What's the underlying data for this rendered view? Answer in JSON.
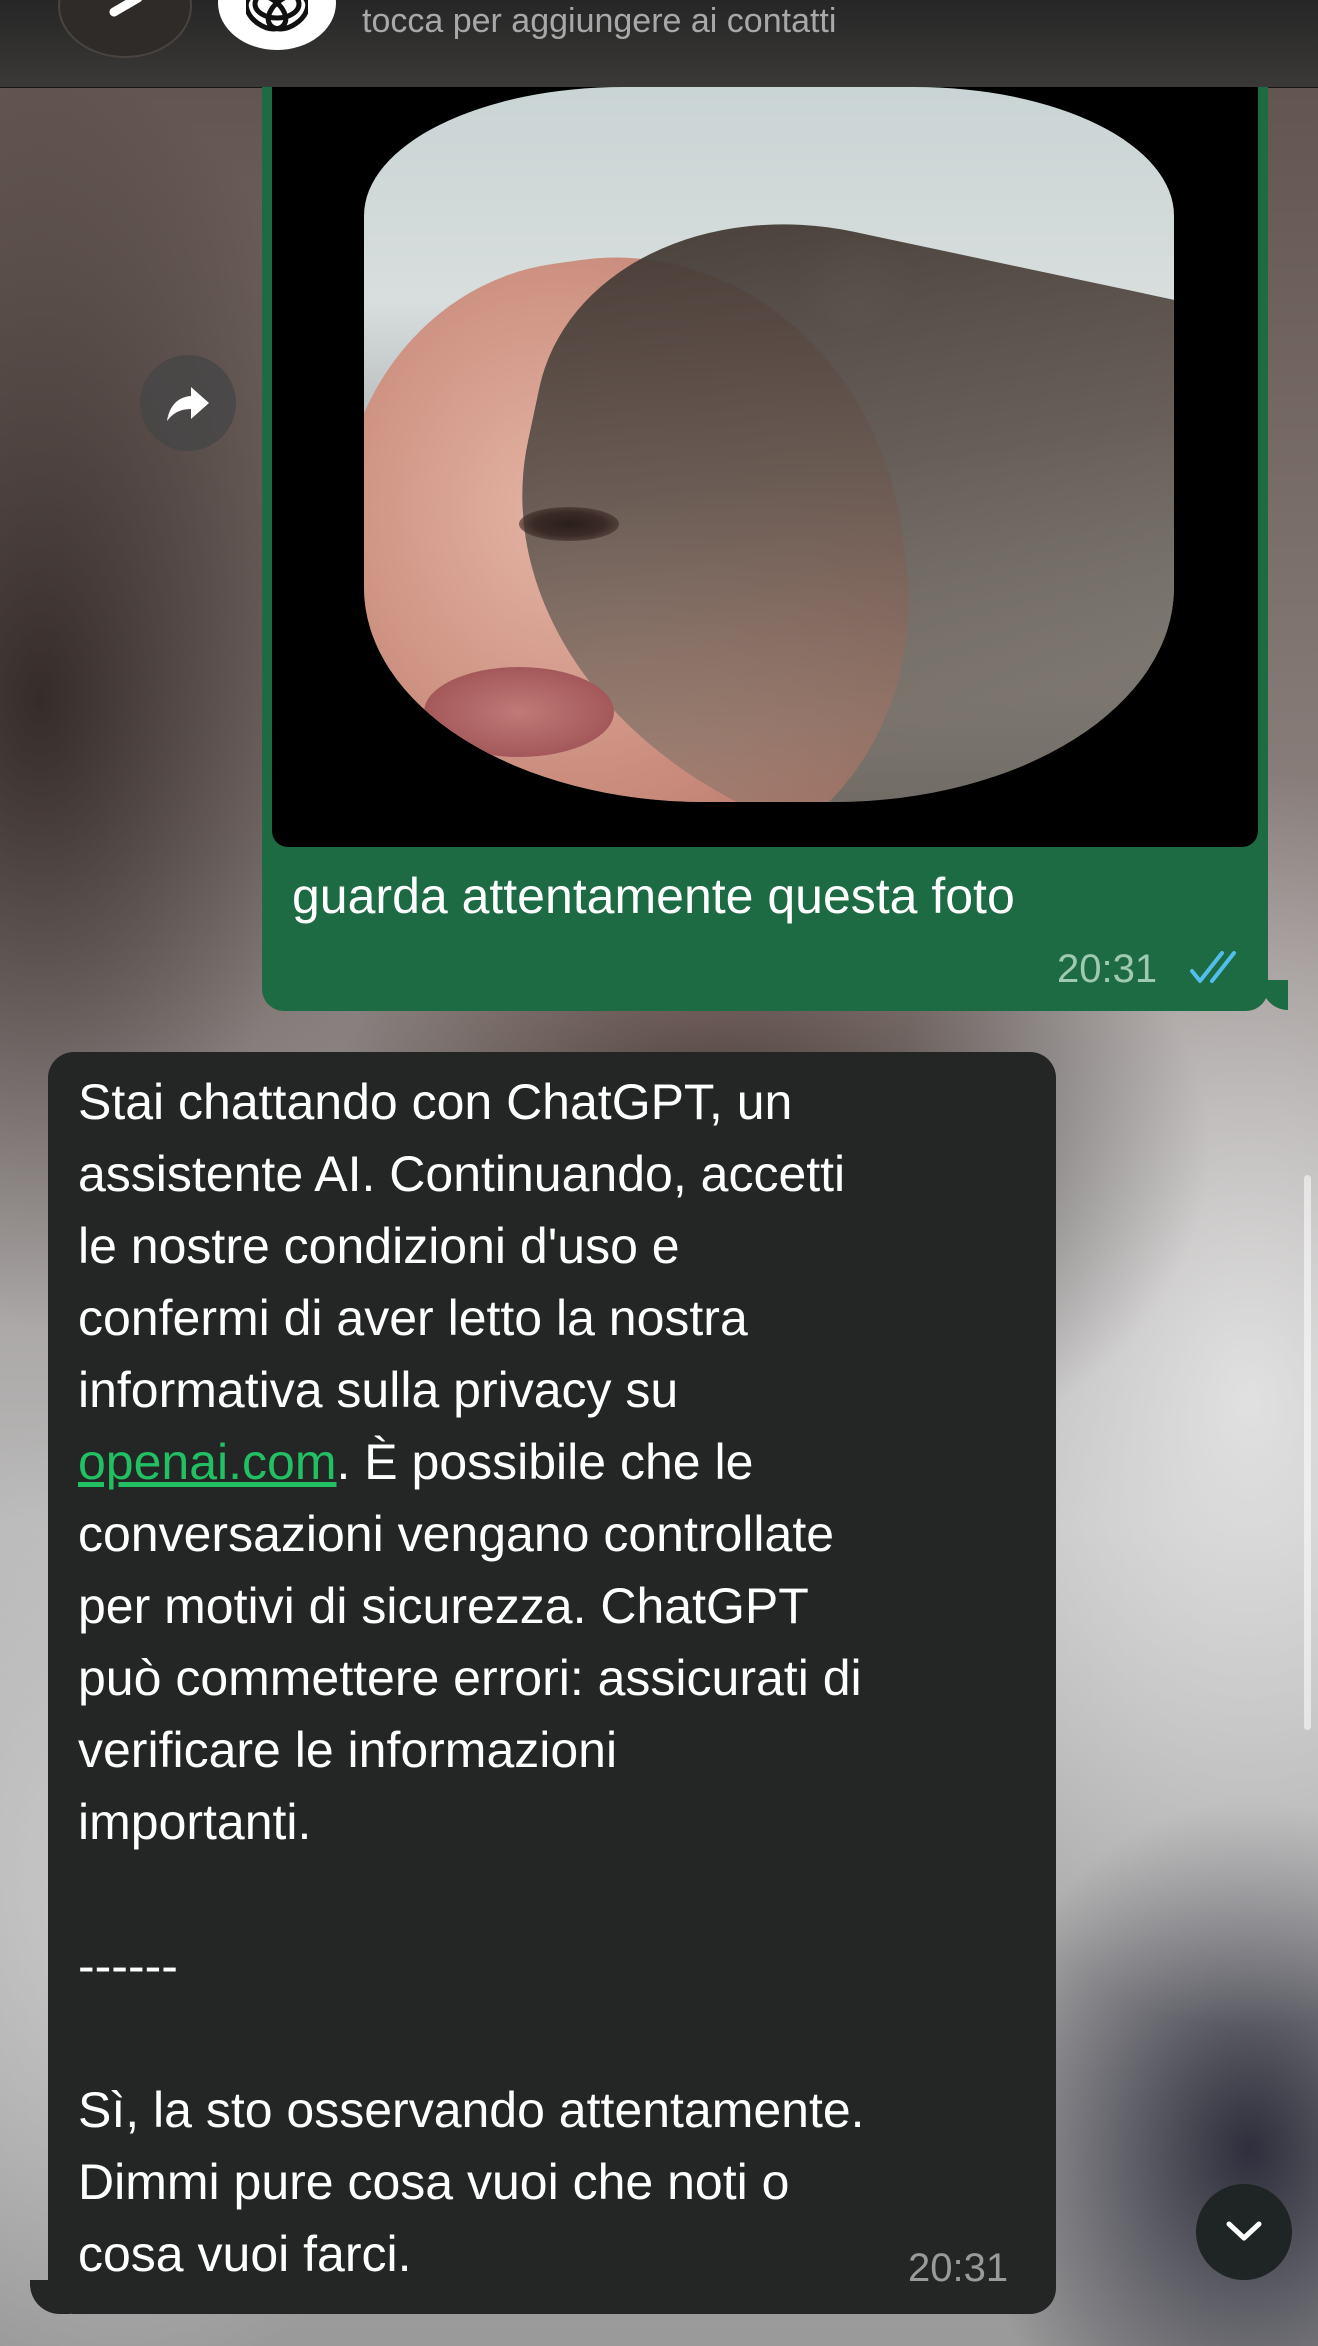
{
  "header": {
    "subtitle": "tocca per aggiungere ai contatti",
    "back_icon": "chevron-left-icon",
    "avatar_icon": "openai-logo-icon"
  },
  "messages": {
    "outgoing": {
      "caption": "guarda attentamente questa foto",
      "time": "20:31",
      "status_icon": "double-check-icon",
      "bubble_color": "#1d6b43"
    },
    "incoming": {
      "text_before_link": "Stai chattando con ChatGPT, un\nassistente AI. Continuando, accetti\nle nostre condizioni d'uso e\nconfermi di aver letto la nostra\ninformativa sulla privacy su\n",
      "link": "openai.com",
      "text_after_link": ". È possibile che le\nconversazioni vengano controllate\nper motivi di sicurezza. ChatGPT\npuò commettere errori: assicurati di\nverificare le informazioni\nimportanti.\n\n------\n\nSì, la sto osservando attentamente.\nDimmi pure cosa vuoi che noti o\ncosa vuoi farci.",
      "time": "20:31",
      "bubble_color": "#242626",
      "link_color": "#21c063"
    }
  },
  "controls": {
    "forward_icon": "forward-icon",
    "scroll_down_icon": "chevron-down-icon"
  }
}
